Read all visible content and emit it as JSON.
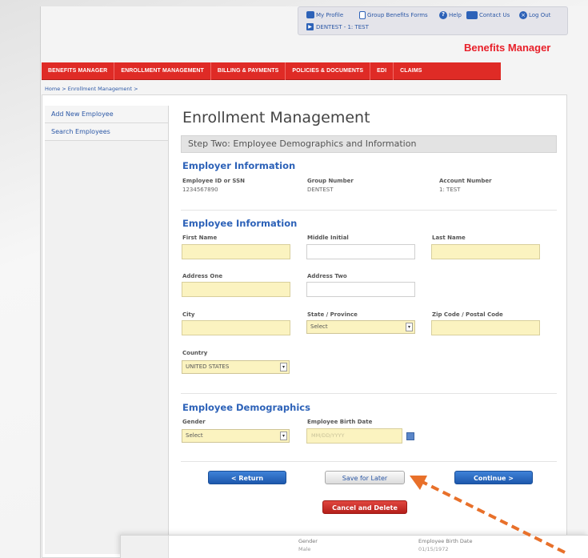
{
  "utility": {
    "my_profile": "My Profile",
    "group_forms": "Group Benefits Forms",
    "help": "Help",
    "contact_us": "Contact Us",
    "log_out": "Log Out",
    "account_selector": "DENTEST - 1: TEST"
  },
  "brand": "Benefits Manager",
  "nav": [
    "BENEFITS MANAGER",
    "ENROLLMENT MANAGEMENT",
    "BILLING & PAYMENTS",
    "POLICIES & DOCUMENTS",
    "EDI",
    "CLAIMS"
  ],
  "breadcrumb": "Home > Enrollment Management >",
  "sidebar": [
    "Add New Employee",
    "Search Employees"
  ],
  "main": {
    "title": "Enrollment Management",
    "step": "Step Two: Employee Demographics and Information"
  },
  "employer": {
    "heading": "Employer Information",
    "fields": [
      {
        "label": "Employee ID or SSN",
        "value": "1234567890"
      },
      {
        "label": "Group Number",
        "value": "DENTEST"
      },
      {
        "label": "Account Number",
        "value": "1: TEST"
      }
    ]
  },
  "employee": {
    "heading": "Employee Information",
    "first_name": "First Name",
    "middle_initial": "Middle Initial",
    "last_name": "Last Name",
    "address_one": "Address One",
    "address_two": "Address Two",
    "city": "City",
    "state": "State / Province",
    "state_value": "Select",
    "zip": "Zip Code / Postal Code",
    "country": "Country",
    "country_value": "UNITED STATES"
  },
  "demographics": {
    "heading": "Employee Demographics",
    "gender": "Gender",
    "gender_value": "Select",
    "birth_date": "Employee Birth Date",
    "birth_placeholder": "MM/DD/YYYY"
  },
  "buttons": {
    "return": "< Return",
    "save": "Save for Later",
    "continue": "Continue >",
    "cancel": "Cancel and Delete"
  },
  "overlay": {
    "gender_label": "Gender",
    "gender_value": "Male",
    "birth_label": "Employee Birth Date",
    "birth_value": "01/15/1972"
  },
  "colors": {
    "nav_red": "#df2b26",
    "brand_red": "#e8202a",
    "heading_blue": "#2d62b8",
    "field_yellow": "#fbf3c0",
    "annotation_arrow": "#e8702a"
  }
}
